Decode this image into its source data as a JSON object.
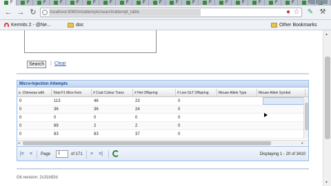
{
  "browser": {
    "tabs": [
      {
        "label": "F"
      },
      {
        "label": "F"
      },
      {
        "label": "F"
      },
      {
        "label": "F"
      },
      {
        "label": "F"
      },
      {
        "label": "F"
      },
      {
        "label": "F"
      },
      {
        "label": "F"
      },
      {
        "label": "F"
      },
      {
        "label": "F"
      },
      {
        "label": "F"
      },
      {
        "label": "F"
      },
      {
        "label": "F"
      },
      {
        "label": "F"
      },
      {
        "label": "F"
      },
      {
        "label": "F"
      },
      {
        "label": "F"
      },
      {
        "label": "F"
      },
      {
        "label": "F"
      },
      {
        "label": "F"
      }
    ],
    "url": "localhost:8080/mi/attempts/search/attempt_table",
    "toolbar_icons": [
      "back-icon",
      "forward-icon",
      "reload-icon",
      "page-icon",
      "adblock-icon",
      "star-icon",
      "pen-tool-icon",
      "wrench-icon"
    ]
  },
  "bookmarks": {
    "items": [
      {
        "label": "Kermits 2 - @Ne...",
        "icon": "arch-icon"
      },
      {
        "label": "doc",
        "icon": "folder-icon"
      }
    ],
    "other": "Other Bookmarks"
  },
  "form": {
    "search_label": "Search",
    "separator": "|",
    "clear_label": "Clear"
  },
  "grid": {
    "title": "Micro-Injection Attempts",
    "columns": [
      "e. Chimeras with",
      "Total F1 Mice from",
      "# Coat Colour Trans",
      "# Het Offspring",
      "# Live GLT Offspring",
      "Mouse Allele Type",
      "Mouse Allele Symbol"
    ],
    "rows": [
      [
        "0",
        "113",
        "46",
        "23",
        "0",
        "",
        ""
      ],
      [
        "0",
        "36",
        "36",
        "24",
        "0",
        "",
        ""
      ],
      [
        "0",
        "0",
        "0",
        "0",
        "0",
        "",
        ""
      ],
      [
        "0",
        "69",
        "2",
        "2",
        "0",
        "",
        ""
      ],
      [
        "0",
        "83",
        "83",
        "37",
        "0",
        "",
        ""
      ]
    ],
    "pager": {
      "first": "|<",
      "prev": "<",
      "page_label": "Page",
      "page_value": "1",
      "of_label": "of 171",
      "next": ">",
      "last": ">|",
      "display": "Displaying 1 - 20 of 3410"
    }
  },
  "footer": {
    "git_revision": "Git revision: 2c31b92d"
  },
  "colors": {
    "panel_title": "#15428b",
    "panel_border": "#99bbe8",
    "link": "#3355aa"
  }
}
